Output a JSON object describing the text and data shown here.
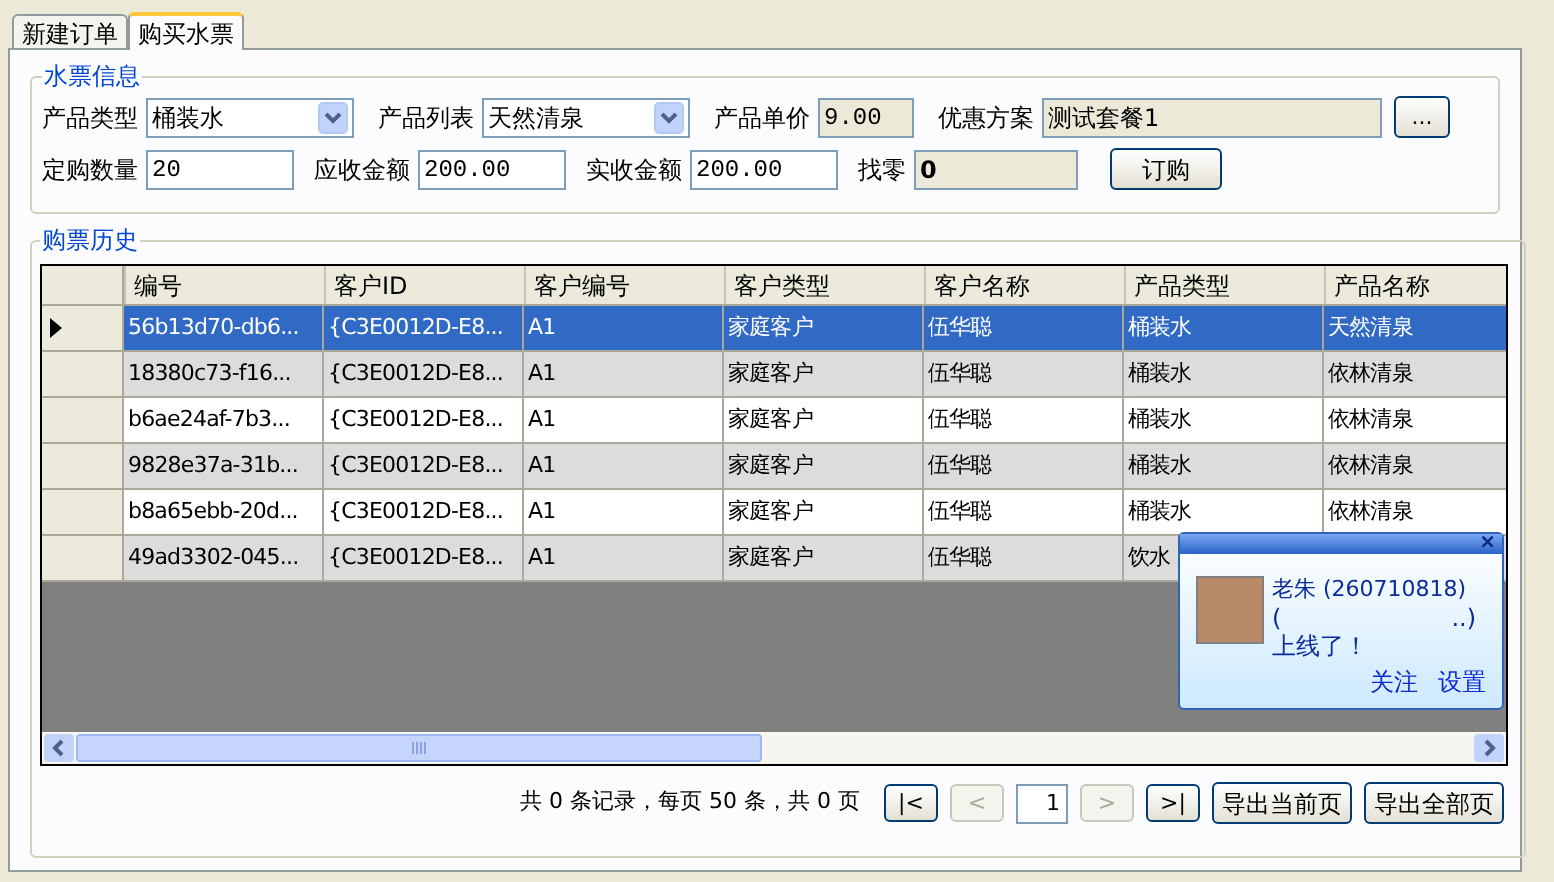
{
  "tabs": [
    {
      "label": "新建订单",
      "selected": false
    },
    {
      "label": "购买水票",
      "selected": true
    }
  ],
  "ticket_info": {
    "title": "水票信息",
    "row_1": [
      {
        "kind": "select",
        "label": "产品类型",
        "value": "桶装水"
      },
      {
        "kind": "select",
        "label": "产品列表",
        "value": "天然清泉"
      },
      {
        "kind": "readonly",
        "label": "产品单价",
        "value": "9.00"
      },
      {
        "kind": "picker",
        "label": "优惠方案",
        "value": "测试套餐1",
        "button": "..."
      }
    ],
    "row_2": [
      {
        "kind": "input",
        "label": "定购数量",
        "value": "20"
      },
      {
        "kind": "input",
        "label": "应收金额",
        "value": "200.00"
      },
      {
        "kind": "input",
        "label": "实收金额",
        "value": "200.00"
      },
      {
        "kind": "bold",
        "label": "找零",
        "value": "0"
      }
    ],
    "order_button": "订购"
  },
  "history": {
    "title": "购票历史",
    "columns": [
      "编号",
      "客户ID",
      "客户编号",
      "客户类型",
      "客户名称",
      "产品类型",
      "产品名称"
    ],
    "rows": [
      {
        "selected": true,
        "cells": [
          "56b13d70-db6...",
          "{C3E0012D-E8...",
          "A1",
          "家庭客户",
          "伍华聪",
          "桶装水",
          "天然清泉"
        ]
      },
      {
        "selected": false,
        "cells": [
          "18380c73-f16...",
          "{C3E0012D-E8...",
          "A1",
          "家庭客户",
          "伍华聪",
          "桶装水",
          "依林清泉"
        ]
      },
      {
        "selected": false,
        "cells": [
          "b6ae24af-7b3...",
          "{C3E0012D-E8...",
          "A1",
          "家庭客户",
          "伍华聪",
          "桶装水",
          "依林清泉"
        ]
      },
      {
        "selected": false,
        "cells": [
          "9828e37a-31b...",
          "{C3E0012D-E8...",
          "A1",
          "家庭客户",
          "伍华聪",
          "桶装水",
          "依林清泉"
        ]
      },
      {
        "selected": false,
        "cells": [
          "b8a65ebb-20d...",
          "{C3E0012D-E8...",
          "A1",
          "家庭客户",
          "伍华聪",
          "桶装水",
          "依林清泉"
        ]
      },
      {
        "selected": false,
        "cells": [
          "49ad3302-045...",
          "{C3E0012D-E8...",
          "A1",
          "家庭客户",
          "伍华聪",
          "饮水"
        ]
      }
    ],
    "pager": {
      "summary": "共 0 条记录，每页 50 条，共 0 页",
      "page": "1",
      "buttons": [
        {
          "kind": "nav",
          "label": "|<",
          "disabled": false
        },
        {
          "kind": "nav",
          "label": "<",
          "disabled": true
        },
        {
          "kind": "page"
        },
        {
          "kind": "nav",
          "label": ">",
          "disabled": true
        },
        {
          "kind": "nav",
          "label": ">|",
          "disabled": false
        },
        {
          "kind": "export",
          "label": "导出当前页",
          "disabled": false
        },
        {
          "kind": "export",
          "label": "导出全部页",
          "disabled": false
        }
      ]
    }
  },
  "notification": {
    "close": "×",
    "name": "老朱 (260710818)",
    "status": [
      "(",
      "..)"
    ],
    "message": "上线了！",
    "links": [
      "关注",
      "设置"
    ]
  }
}
